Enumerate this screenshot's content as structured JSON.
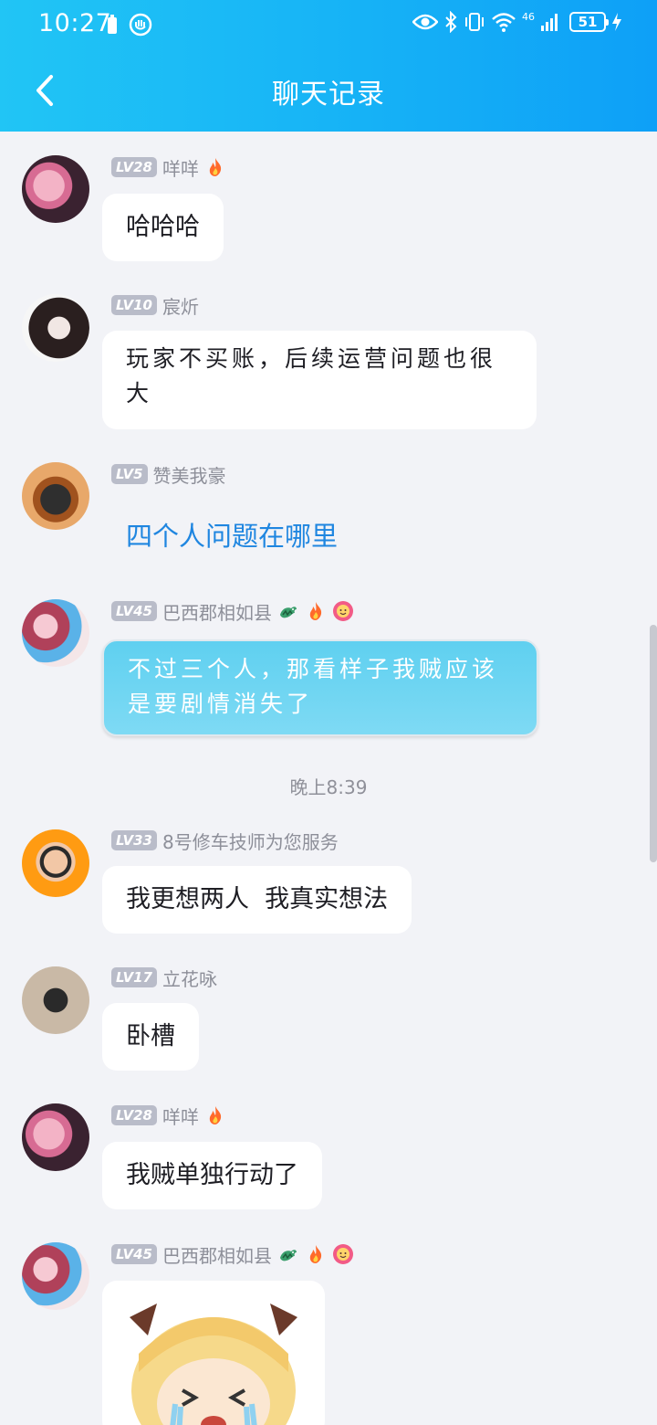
{
  "status_bar": {
    "time": "10:27",
    "battery": "51",
    "network": "46"
  },
  "header": {
    "title": "聊天记录"
  },
  "messages": [
    {
      "level": "LV28",
      "name": "咩咩",
      "text": "哈哈哈"
    },
    {
      "level": "LV10",
      "name": "宸炘",
      "text": "玩家不买账，后续运营问题也很大"
    },
    {
      "level": "LV5",
      "name": "赞美我豪",
      "text": "四个人问题在哪里"
    },
    {
      "level": "LV45",
      "name": "巴西郡相如县",
      "text": "不过三个人，那看样子我贼应该是要剧情消失了"
    },
    {
      "level": "LV33",
      "name": "8号修车技师为您服务",
      "text": "我更想两人  我真实想法"
    },
    {
      "level": "LV17",
      "name": "立花咏",
      "text": "卧槽"
    },
    {
      "level": "LV28",
      "name": "咩咩",
      "text": "我贼单独行动了"
    },
    {
      "level": "LV45",
      "name": "巴西郡相如县",
      "text": ""
    }
  ],
  "timestamp": "晚上8:39",
  "colors": {
    "header_start": "#21c5f5",
    "header_end": "#0ea0f7",
    "link_blue": "#1f86e0",
    "background": "#f2f3f7"
  }
}
